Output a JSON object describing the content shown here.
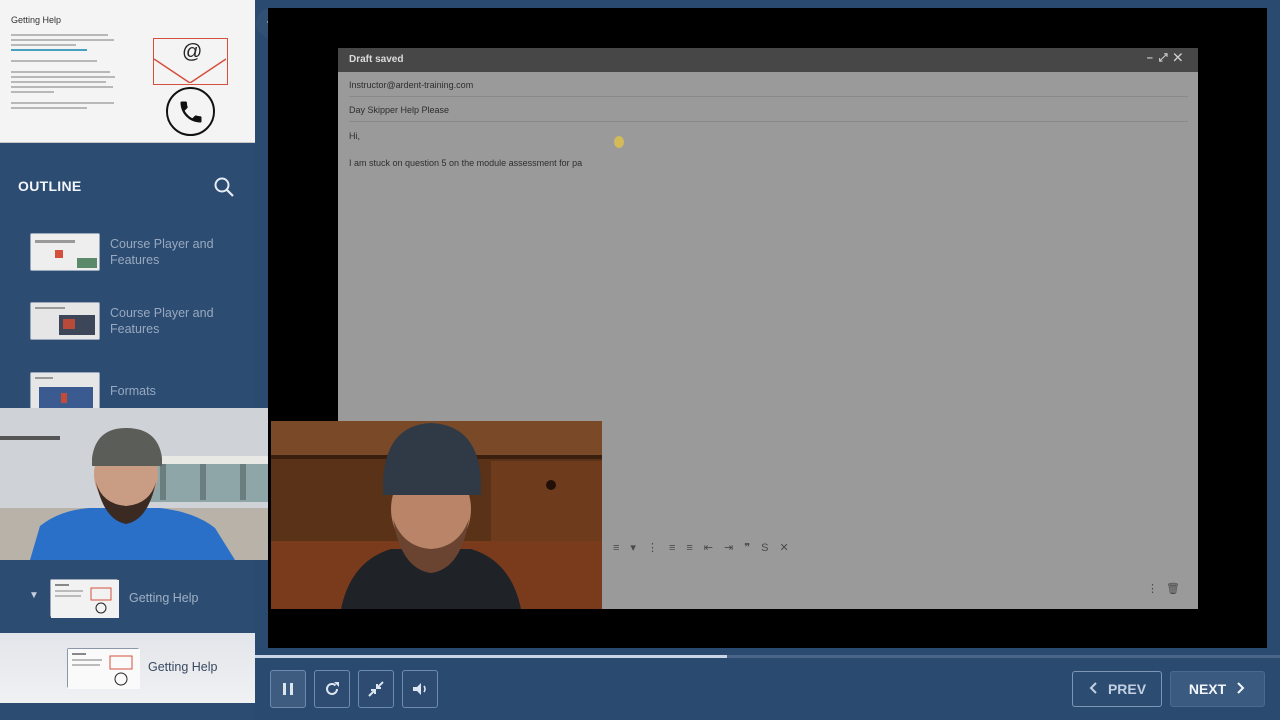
{
  "sidebar": {
    "current_slide": {
      "title": "Getting Help",
      "at_symbol": "@"
    },
    "outline": {
      "title": "OUTLINE",
      "items": [
        {
          "label": "Course Player and Features"
        },
        {
          "label": "Course Player and Features"
        },
        {
          "label": "Formats"
        },
        {
          "label": "Getting Help"
        },
        {
          "label": "Getting Help"
        }
      ]
    }
  },
  "email": {
    "status": "Draft saved",
    "to": "Instructor@ardent-training.com",
    "subject": "Day Skipper Help Please",
    "greeting": "Hi,",
    "body": "I am stuck on question 5 on the module assessment for pa"
  },
  "player": {
    "progress_percent": 46,
    "prev_label": "PREV",
    "next_label": "NEXT"
  },
  "colors": {
    "sidebar": "#2d4c72",
    "stage": "#000000",
    "accent": "#d4503c"
  }
}
